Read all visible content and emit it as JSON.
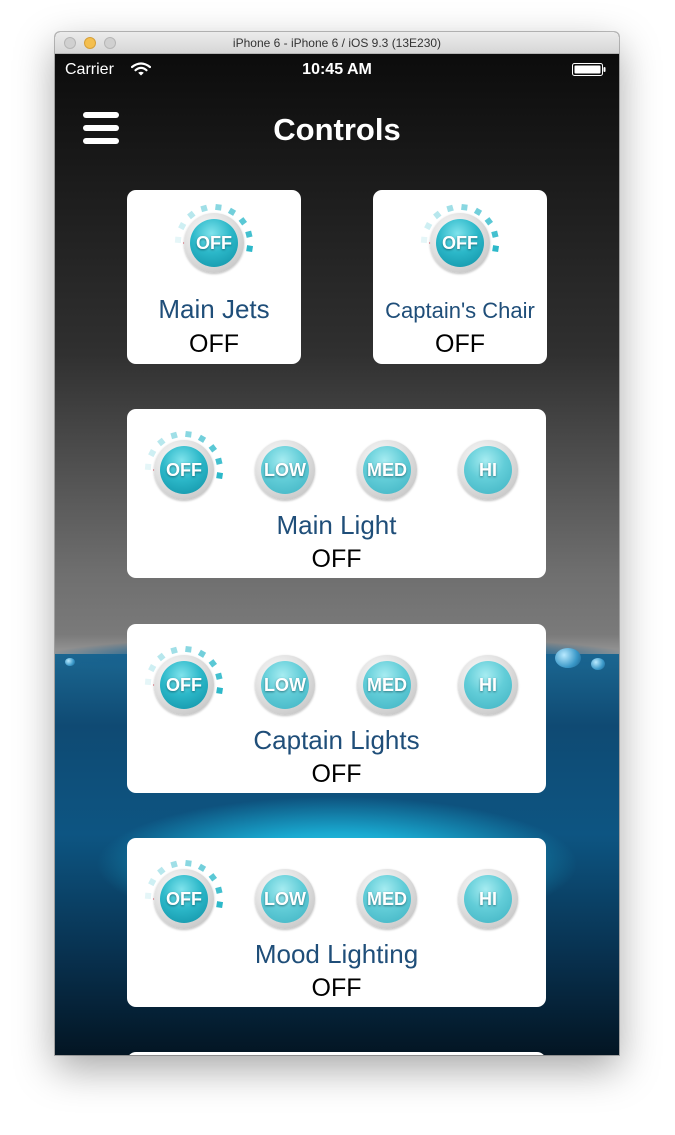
{
  "window": {
    "title": "iPhone 6 - iPhone 6 / iOS 9.3 (13E230)"
  },
  "status_bar": {
    "carrier": "Carrier",
    "time": "10:45 AM"
  },
  "header": {
    "title": "Controls"
  },
  "colors": {
    "accent": "#2cb8c9",
    "label": "#1f4e79",
    "indicator": "#d0021b"
  },
  "controls": [
    {
      "name": "Main Jets",
      "state": "OFF",
      "buttons": [
        "OFF"
      ]
    },
    {
      "name": "Captain's Chair",
      "state": "OFF",
      "buttons": [
        "OFF"
      ]
    },
    {
      "name": "Main Light",
      "state": "OFF",
      "buttons": [
        "OFF",
        "LOW",
        "MED",
        "HI"
      ]
    },
    {
      "name": "Captain Lights",
      "state": "OFF",
      "buttons": [
        "OFF",
        "LOW",
        "MED",
        "HI"
      ]
    },
    {
      "name": "Mood Lighting",
      "state": "OFF",
      "buttons": [
        "OFF",
        "LOW",
        "MED",
        "HI"
      ]
    }
  ]
}
